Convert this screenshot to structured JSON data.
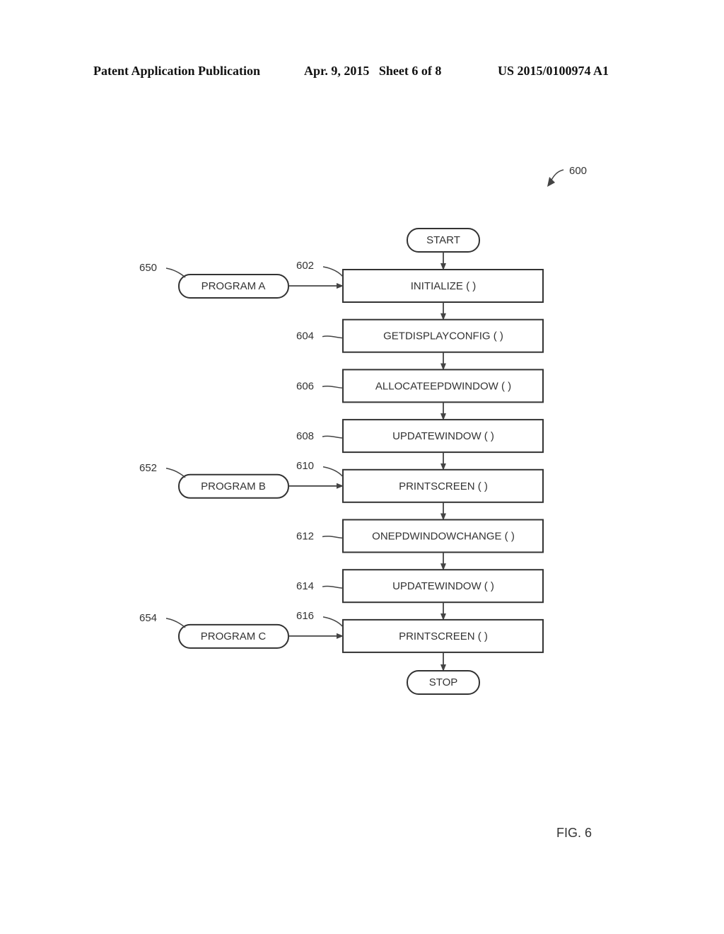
{
  "header": {
    "left": "Patent Application Publication",
    "middle": "Apr. 9, 2015   Sheet 6 of 8",
    "right": "US 2015/0100974 A1"
  },
  "figure": {
    "ref": "600",
    "caption": "FIG. 6",
    "start_label": "START",
    "stop_label": "STOP",
    "steps": [
      {
        "ref": "602",
        "label": "INITIALIZE ( )"
      },
      {
        "ref": "604",
        "label": "GETDISPLAYCONFIG ( )"
      },
      {
        "ref": "606",
        "label": "ALLOCATEEPDWINDOW ( )"
      },
      {
        "ref": "608",
        "label": "UPDATEWINDOW ( )"
      },
      {
        "ref": "610",
        "label": "PRINTSCREEN ( )"
      },
      {
        "ref": "612",
        "label": "ONEPDWINDOWCHANGE ( )"
      },
      {
        "ref": "614",
        "label": "UPDATEWINDOW ( )"
      },
      {
        "ref": "616",
        "label": "PRINTSCREEN ( )"
      }
    ],
    "programs": [
      {
        "ref": "650",
        "label": "PROGRAM A",
        "target_step": 0
      },
      {
        "ref": "652",
        "label": "PROGRAM B",
        "target_step": 4
      },
      {
        "ref": "654",
        "label": "PROGRAM C",
        "target_step": 7
      }
    ]
  }
}
